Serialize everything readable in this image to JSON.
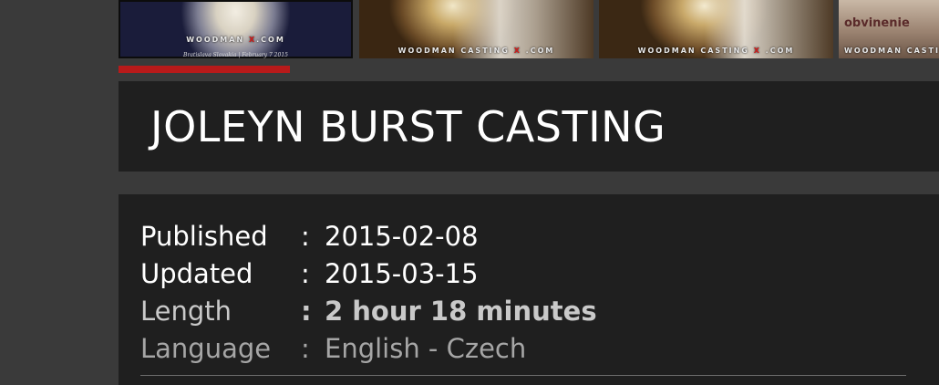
{
  "thumbnails": [
    {
      "caption_prefix": "WOODMAN",
      "caption_suffix": ".COM",
      "subcaption": "Bratislava Slovakia | February 7 2015"
    },
    {
      "caption_prefix": "WOODMAN CASTING",
      "caption_suffix": ".COM"
    },
    {
      "caption_prefix": "WOODMAN CASTING",
      "caption_suffix": ".COM"
    },
    {
      "sign_text": "obvinenie",
      "caption_prefix": "WOODMAN CASTING"
    }
  ],
  "thumbnail_x_glyph": "X",
  "progress": {
    "fraction": 0.209,
    "color": "#b81a1a"
  },
  "title": "JOLEYN BURST CASTING",
  "details": {
    "separator": ":",
    "published": {
      "label": "Published",
      "value": "2015-02-08"
    },
    "updated": {
      "label": "Updated",
      "value": "2015-03-15"
    },
    "length": {
      "label": "Length",
      "value": "2 hour 18 minutes"
    },
    "language": {
      "label": "Language",
      "value": "English - Czech"
    }
  },
  "colors": {
    "page_background": "#3a3a3a",
    "panel_background": "#1f1f1f",
    "accent_red": "#b81a1a"
  }
}
